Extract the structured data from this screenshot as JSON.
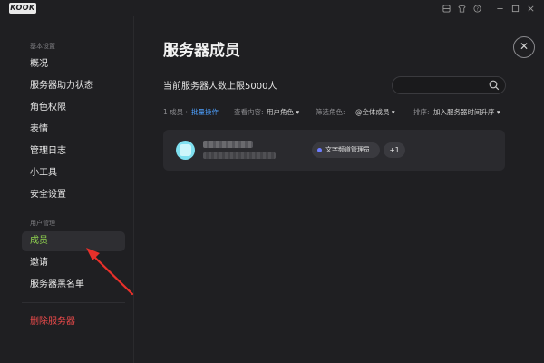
{
  "app": {
    "logo_text": "KOOK"
  },
  "titlebar": {
    "icons": [
      "inbox-icon",
      "shirt-icon",
      "help-icon",
      "minimize-icon",
      "maximize-icon",
      "close-icon"
    ]
  },
  "sidebar": {
    "section1_label": "基本设置",
    "section1_items": [
      "概况",
      "服务器助力状态",
      "角色权限",
      "表情",
      "管理日志",
      "小工具",
      "安全设置"
    ],
    "section2_label": "用户管理",
    "section2_items": [
      "成员",
      "邀请",
      "服务器黑名单"
    ],
    "danger_item": "删除服务器",
    "active_item": "成员"
  },
  "main": {
    "title": "服务器成员",
    "limit_text": "当前服务器人数上限5000人",
    "search_placeholder": "",
    "filters": {
      "count": "1 成员 ·",
      "batch": "批量操作",
      "view_label": "查看内容:",
      "view_value": "用户角色",
      "role_label": "筛选角色:",
      "role_value": "@全体成员",
      "sort_label": "排序:",
      "sort_value": "加入服务器时间升序"
    },
    "members": [
      {
        "role": "文字频道管理员",
        "more": "+1"
      }
    ]
  },
  "colors": {
    "accent_green": "#8fd14f",
    "link_blue": "#4ea0ff",
    "danger_red": "#ee4b4b",
    "arrow_red": "#e8302a",
    "role_dot": "#6e7dff"
  }
}
